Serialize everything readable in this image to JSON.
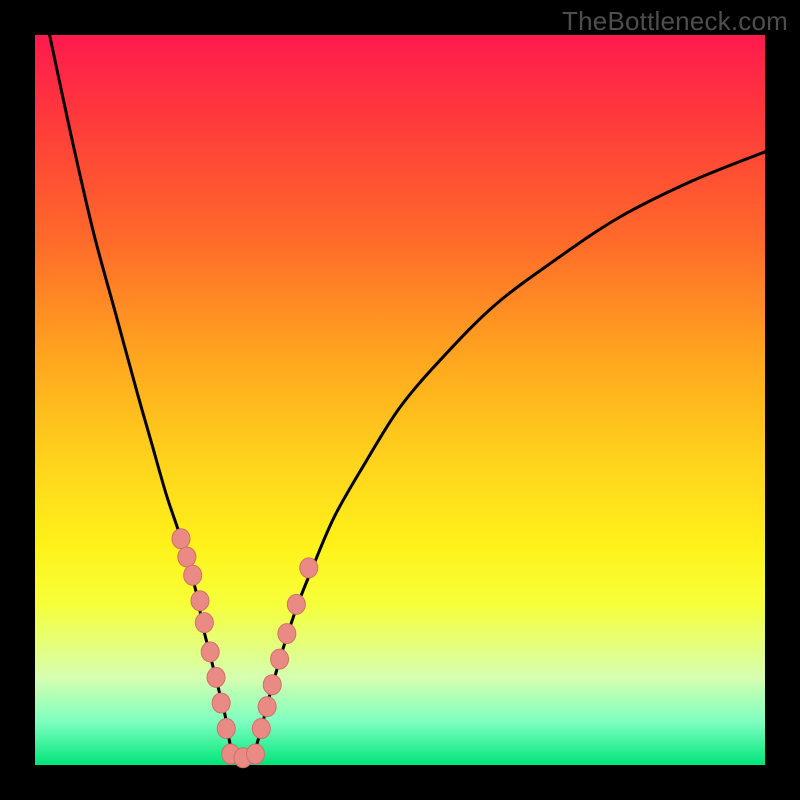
{
  "watermark": "TheBottleneck.com",
  "chart_data": {
    "type": "line",
    "title": "",
    "xlabel": "",
    "ylabel": "",
    "xlim": [
      0,
      100
    ],
    "ylim": [
      0,
      100
    ],
    "grid": false,
    "legend": false,
    "series": [
      {
        "name": "left-branch",
        "x": [
          2,
          5,
          8,
          11,
          14,
          16,
          18,
          20,
          22,
          23,
          24,
          25,
          26,
          26.5,
          27
        ],
        "y": [
          100,
          86,
          73,
          62,
          51,
          44,
          37,
          31,
          24,
          19,
          15,
          11,
          7,
          4,
          1.5
        ]
      },
      {
        "name": "right-branch",
        "x": [
          30,
          31,
          32,
          34,
          36,
          38,
          41,
          45,
          50,
          56,
          63,
          71,
          80,
          90,
          100
        ],
        "y": [
          1.5,
          5,
          9,
          16,
          22,
          27,
          34,
          41,
          49,
          56,
          63,
          69,
          75,
          80,
          84
        ]
      },
      {
        "name": "valley-floor",
        "x": [
          27,
          28.5,
          30
        ],
        "y": [
          1.5,
          1.0,
          1.5
        ]
      }
    ],
    "markers": [
      {
        "name": "left-branch-dots",
        "points": [
          {
            "x": 20.0,
            "y": 31.0
          },
          {
            "x": 20.8,
            "y": 28.5
          },
          {
            "x": 21.6,
            "y": 26.0
          },
          {
            "x": 22.6,
            "y": 22.5
          },
          {
            "x": 23.2,
            "y": 19.5
          },
          {
            "x": 24.0,
            "y": 15.5
          },
          {
            "x": 24.8,
            "y": 12.0
          },
          {
            "x": 25.5,
            "y": 8.5
          },
          {
            "x": 26.2,
            "y": 5.0
          }
        ]
      },
      {
        "name": "right-branch-dots",
        "points": [
          {
            "x": 31.0,
            "y": 5.0
          },
          {
            "x": 31.8,
            "y": 8.0
          },
          {
            "x": 32.5,
            "y": 11.0
          },
          {
            "x": 33.5,
            "y": 14.5
          },
          {
            "x": 34.5,
            "y": 18.0
          },
          {
            "x": 35.8,
            "y": 22.0
          },
          {
            "x": 37.5,
            "y": 27.0
          }
        ]
      },
      {
        "name": "floor-dots",
        "points": [
          {
            "x": 26.8,
            "y": 1.5
          },
          {
            "x": 28.5,
            "y": 1.0
          },
          {
            "x": 30.2,
            "y": 1.5
          }
        ]
      }
    ],
    "colors": {
      "curve": "#000000",
      "marker_fill": "#e98b84",
      "marker_stroke": "#cf6f68",
      "gradient_top": "#ff1a4d",
      "gradient_bottom": "#00e57a"
    }
  }
}
